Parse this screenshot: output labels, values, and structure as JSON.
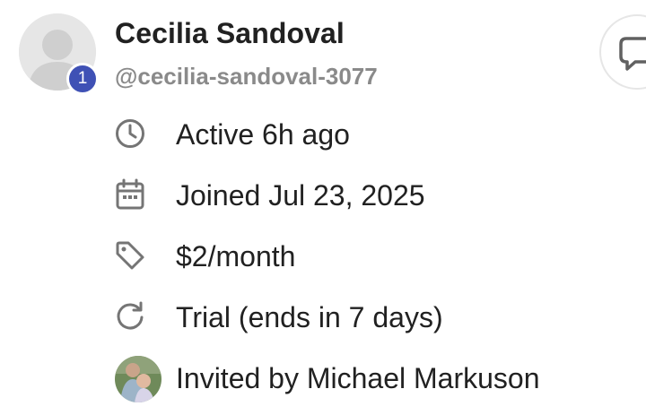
{
  "profile": {
    "name": "Cecilia Sandoval",
    "handle": "@cecilia-sandoval-3077",
    "badge_count": "1"
  },
  "details": {
    "active": "Active 6h ago",
    "joined": "Joined Jul 23, 2025",
    "price": "$2/month",
    "trial": "Trial (ends in 7 days)",
    "invited": "Invited by Michael Markuson"
  },
  "icons": {
    "avatar": "user-placeholder-icon",
    "message": "chat-bubble-icon",
    "active": "clock-icon",
    "joined": "calendar-icon",
    "price": "tag-icon",
    "trial": "refresh-icon",
    "inviter": "inviter-photo"
  },
  "colors": {
    "badge": "#3f51b5",
    "text": "#212121",
    "muted": "#8a8a8a",
    "icon": "#757575"
  }
}
